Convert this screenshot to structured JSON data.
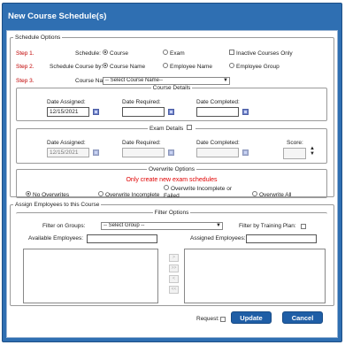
{
  "dialog": {
    "title": "New Course Schedule(s)"
  },
  "schedule_options": {
    "legend": "Schedule Options",
    "step1": {
      "step": "Step 1.",
      "label": "Schedule:",
      "options": [
        "Course",
        "Exam"
      ],
      "selected": "Course",
      "checkbox_label": "Inactive Courses Only"
    },
    "step2": {
      "step": "Step 2.",
      "label": "Schedule Course by:",
      "options": [
        "Course Name",
        "Employee Name",
        "Employee Group"
      ],
      "selected": "Course Name"
    },
    "step3": {
      "step": "Step 3.",
      "label": "Course Name:",
      "select_value": "-- Select Course Name--"
    },
    "course_details": {
      "legend": "Course Details",
      "date_assigned_label": "Date Assigned:",
      "date_assigned_value": "12/15/2021",
      "date_required_label": "Date Required:",
      "date_required_value": "",
      "date_completed_label": "Date Completed:",
      "date_completed_value": ""
    },
    "exam_details": {
      "legend": "Exam Details",
      "date_assigned_label": "Date Assigned:",
      "date_assigned_value": "12/15/2021",
      "date_required_label": "Date Required:",
      "date_required_value": "",
      "date_completed_label": "Date Completed:",
      "date_completed_value": "",
      "score_label": "Score:",
      "score_value": ""
    },
    "overwrite_options": {
      "legend": "Overwrite Options",
      "message": "Only create new exam schedules",
      "options": [
        "No Overwrites",
        "Overwrite Incomplete",
        "Overwrite Incomplete or Failed",
        "Overwrite All"
      ],
      "selected": "No Overwrites"
    }
  },
  "assign": {
    "legend": "Assign Employees to this Course",
    "filter_options": {
      "legend": "Filter Options",
      "filter_label": "Filter on Groups:",
      "group_select": "-- Select Group --",
      "training_plan_label": "Filter by Training Plan:"
    },
    "available_label": "Available Employees:",
    "assigned_label": "Assigned Employees:",
    "move_buttons": [
      ">",
      ">>",
      "<",
      "<<"
    ]
  },
  "footer": {
    "request_label": "Request:",
    "update_label": "Update",
    "cancel_label": "Cancel"
  },
  "colors": {
    "title_bar": "#2f6fb2",
    "button": "#1f5ea6",
    "step_text": "#c00000",
    "warning_text": "#e00000"
  }
}
